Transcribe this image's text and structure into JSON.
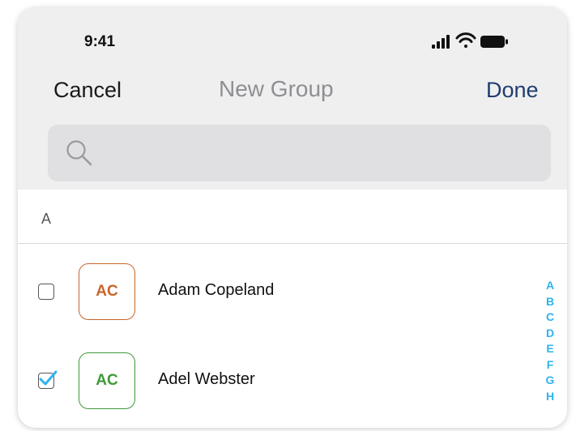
{
  "status_bar": {
    "time": "9:41",
    "icons": [
      "signal-icon",
      "wifi-icon",
      "battery-icon"
    ]
  },
  "navbar": {
    "cancel_label": "Cancel",
    "title": "New Group",
    "done_label": "Done"
  },
  "search": {
    "placeholder": "",
    "value": ""
  },
  "section": {
    "letter": "A"
  },
  "contacts": [
    {
      "initials": "AC",
      "name": "Adam Copeland",
      "checked": false,
      "color": "#c8652c"
    },
    {
      "initials": "AC",
      "name": "Adel Webster",
      "checked": true,
      "color": "#3e9a3a"
    }
  ],
  "index_letters": [
    "A",
    "B",
    "C",
    "D",
    "E",
    "F",
    "G",
    "H"
  ],
  "colors": {
    "accent_blue": "#2db4ee",
    "done_navy": "#1f3d6e",
    "header_bg": "#efeff0"
  }
}
